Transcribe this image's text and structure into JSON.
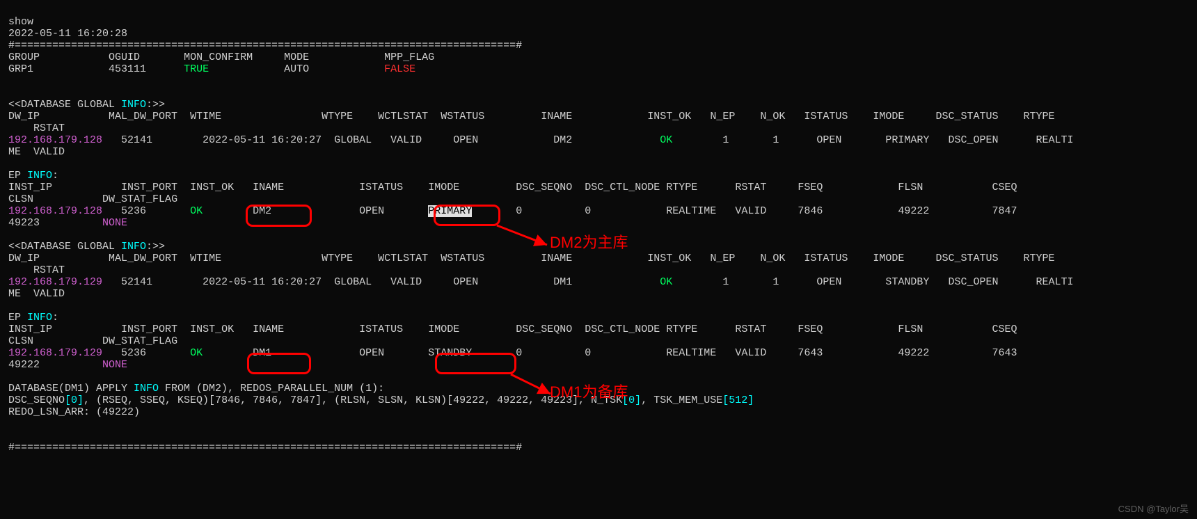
{
  "cmd": "show",
  "ts": "2022-05-11 16:20:28",
  "rule": "#================================================================================#",
  "group_hdr": {
    "c0": "GROUP",
    "c1": "OGUID",
    "c2": "MON_CONFIRM",
    "c3": "MODE",
    "c4": "MPP_FLAG"
  },
  "group_row": {
    "c0": "GRP1",
    "c1": "453111",
    "c2": "TRUE",
    "c3": "AUTO",
    "c4": "FALSE"
  },
  "dbg_title_a": "<<DATABASE GLOBAL ",
  "dbg_title_b": "INFO",
  "dbg_title_c": ":>>",
  "dw_hdr": {
    "c0": "DW_IP",
    "c1": "MAL_DW_PORT",
    "c2": "WTIME",
    "c3": "WTYPE",
    "c4": "WCTLSTAT",
    "c5": "WSTATUS",
    "c6": "INAME",
    "c7": "INST_OK",
    "c8": "N_EP",
    "c9": "N_OK",
    "c10": "ISTATUS",
    "c11": "IMODE",
    "c12": "DSC_STATUS",
    "c13": "RTYPE",
    "c14": "RSTAT"
  },
  "dw1": {
    "ip": "192.168.179.128",
    "port": "52141",
    "wtime": "2022-05-11 16:20:27",
    "wtype": "GLOBAL",
    "wctl": "VALID",
    "wst": "OPEN",
    "iname": "DM2",
    "iok": "OK",
    "nep": "1",
    "nok": "1",
    "ist": "OPEN",
    "imode": "PRIMARY",
    "dsc": "DSC_OPEN",
    "rtype": "REALTI",
    "rtype2": "ME",
    "rstat": "VALID"
  },
  "dw2": {
    "ip": "192.168.179.129",
    "port": "52141",
    "wtime": "2022-05-11 16:20:27",
    "wtype": "GLOBAL",
    "wctl": "VALID",
    "wst": "OPEN",
    "iname": "DM1",
    "iok": "OK",
    "nep": "1",
    "nok": "1",
    "ist": "OPEN",
    "imode": "STANDBY",
    "dsc": "DSC_OPEN",
    "rtype": "REALTI",
    "rtype2": "ME",
    "rstat": "VALID"
  },
  "ep_title_a": "EP ",
  "ep_title_b": "INFO",
  "ep_title_c": ":",
  "ep_hdr": {
    "c0": "INST_IP",
    "c1": "INST_PORT",
    "c2": "INST_OK",
    "c3": "INAME",
    "c4": "ISTATUS",
    "c5": "IMODE",
    "c6": "DSC_SEQNO",
    "c7": "DSC_CTL_NODE",
    "c8": "RTYPE",
    "c9": "RSTAT",
    "c10": "FSEQ",
    "c11": "FLSN",
    "c12": "CSEQ",
    "c13": "CLSN",
    "c14": "DW_STAT_FLAG"
  },
  "ep1": {
    "ip": "192.168.179.128",
    "port": "5236",
    "iok": "OK",
    "iname": "DM2",
    "ist": "OPEN",
    "imode": "PRIMARY",
    "seq": "0",
    "ctl": "0",
    "rtype": "REALTIME",
    "rstat": "VALID",
    "fseq": "7846",
    "flsn": "49222",
    "cseq": "7847",
    "clsn": "49223",
    "flag": "NONE"
  },
  "ep2": {
    "ip": "192.168.179.129",
    "port": "5236",
    "iok": "OK",
    "iname": "DM1",
    "ist": "OPEN",
    "imode": "STANDBY",
    "seq": "0",
    "ctl": "0",
    "rtype": "REALTIME",
    "rstat": "VALID",
    "fseq": "7643",
    "flsn": "49222",
    "cseq": "7643",
    "clsn": "49222",
    "flag": "NONE"
  },
  "apply": {
    "a": "DATABASE(DM1) APPLY ",
    "b": "INFO",
    "c": " FROM (DM2), REDOS_PARALLEL_NUM (1):"
  },
  "line2": {
    "a": "DSC_SEQNO",
    "b": "[0]",
    "c": ", (RSEQ, SSEQ, KSEQ)[7846, 7846, 7847], (RLSN, SLSN, KLSN)[49222, 49222, 49223], N_TSK",
    "d": "[0]",
    "e": ", TSK_MEM_USE",
    "f": "[512]"
  },
  "redo": "REDO_LSN_ARR: (49222)",
  "anno1": "DM2为主库",
  "anno2": "DM1为备库",
  "watermark": "CSDN @Taylor吴"
}
